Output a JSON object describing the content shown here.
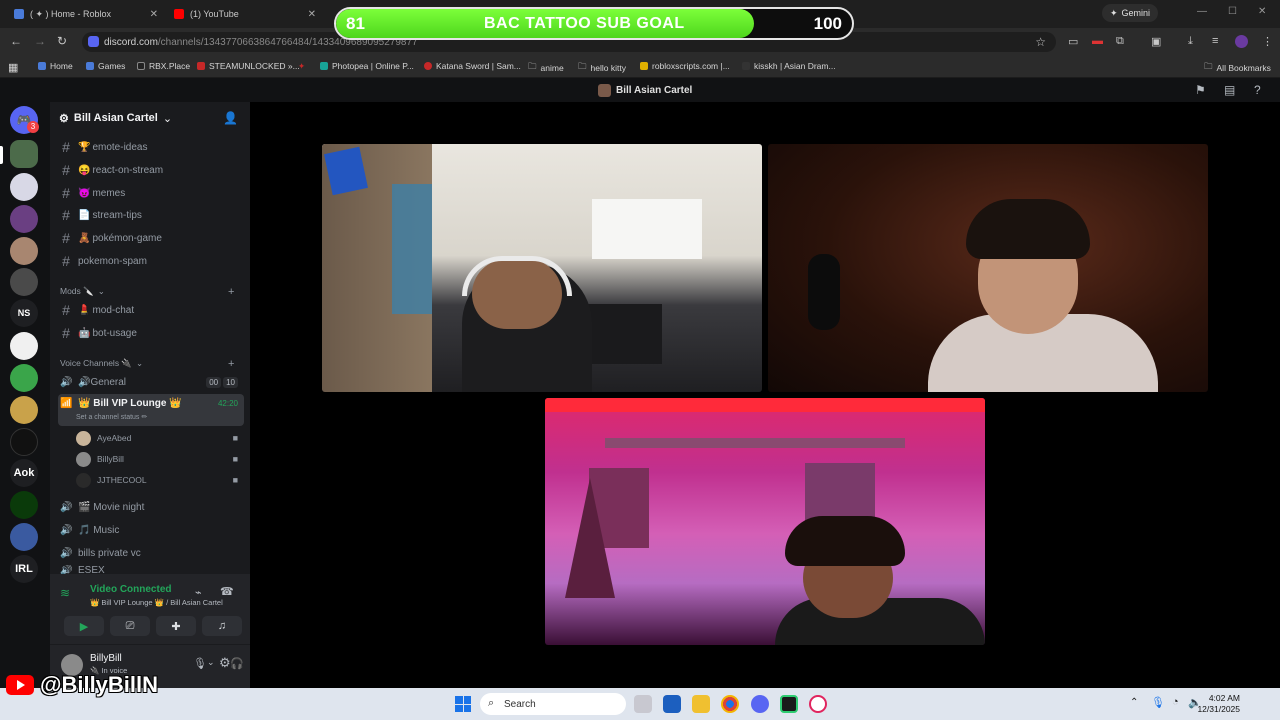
{
  "browser": {
    "tabs": [
      {
        "title": "( ✦ ) Home - Roblox"
      },
      {
        "title": "(1) YouTube"
      }
    ],
    "gemini_label": "Gemini",
    "url_host": "discord.com",
    "url_path": "/channels/1343770663864766484/1433409689095279877"
  },
  "sub_goal": {
    "current": "81",
    "target": "100",
    "label": "BAC TATTOO SUB GOAL",
    "progress": 0.81
  },
  "bookmarks": [
    {
      "label": "Home"
    },
    {
      "label": "Games"
    },
    {
      "label": "RBX.Place"
    },
    {
      "label": "STEAMUNLOCKED »..."
    },
    {
      "label": "Photopea | Online P..."
    },
    {
      "label": "Katana Sword | Sam..."
    },
    {
      "label": "anime"
    },
    {
      "label": "hello kitty"
    },
    {
      "label": "robloxscripts.com |..."
    },
    {
      "label": "kisskh | Asian Dram..."
    }
  ],
  "all_bookmarks_label": "All Bookmarks",
  "discord": {
    "call_title": "Bill Asian Cartel",
    "server_name": "Bill Asian Cartel",
    "dm_badge": "3",
    "text_channels": [
      {
        "name": "emote-ideas",
        "emoji": "🏆"
      },
      {
        "name": "react-on-stream",
        "emoji": "😝"
      },
      {
        "name": "memes",
        "emoji": "😈"
      },
      {
        "name": "stream-tips",
        "emoji": "📄"
      },
      {
        "name": "pokémon-game",
        "emoji": "🧸"
      },
      {
        "name": "pokemon-spam",
        "emoji": ""
      }
    ],
    "mods_category": "Mods 🔪",
    "mod_channels": [
      {
        "name": "mod-chat",
        "emoji": "💄"
      },
      {
        "name": "bot-usage",
        "emoji": "🤖"
      }
    ],
    "voice_category": "Voice Channels 🔌",
    "general": {
      "name": "🔊General",
      "count_a": "00",
      "count_b": "10"
    },
    "active_vc": {
      "name": "👑 Bill VIP Lounge 👑",
      "status": "Set a channel status ✏",
      "timer": "42:20"
    },
    "vc_members": [
      {
        "name": "AyeAbed"
      },
      {
        "name": "BillyBill"
      },
      {
        "name": "JJTHECOOL"
      }
    ],
    "more_channels": [
      {
        "name": "🎬 Movie night"
      },
      {
        "name": "🎵 Music"
      },
      {
        "name": "bills private vc"
      },
      {
        "name": "ESEX"
      }
    ],
    "guild_labels": [
      "NS",
      "Aok",
      "IRL"
    ],
    "voice_status": "Video Connected",
    "voice_location": "👑 Bill VIP Lounge 👑 / Bill Asian Cartel",
    "user_name": "BillyBill",
    "user_status": "🔌 In voice"
  },
  "handle": "@BillyBillN",
  "taskbar": {
    "search_placeholder": "Search",
    "time": "4:02 AM",
    "date": "12/31/2025"
  },
  "colors": {
    "discord_bg": "#1a1b1e",
    "goal_fill": "#5ee824",
    "voice_green": "#23a55a"
  }
}
